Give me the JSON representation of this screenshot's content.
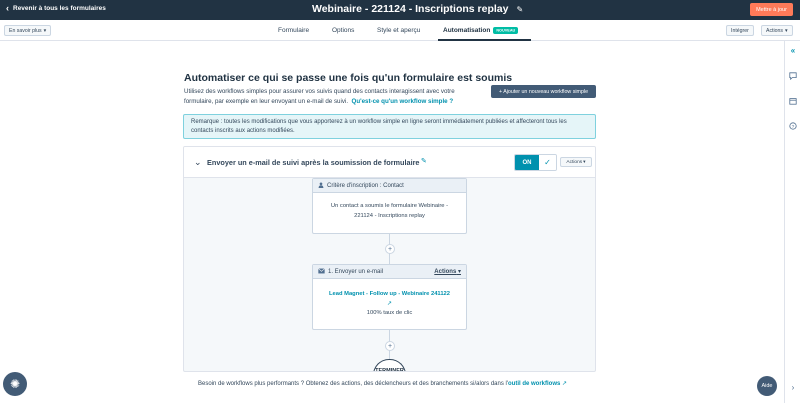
{
  "topbar": {
    "back_label": "Revenir à tous les formulaires",
    "title": "Webinaire - 221124 - Inscriptions replay",
    "update_label": "Mettre à jour"
  },
  "toolbar": {
    "learn_more_label": "En savoir plus",
    "integrate_label": "Intégrer",
    "actions_label": "Actions"
  },
  "tabs": [
    {
      "label": "Formulaire"
    },
    {
      "label": "Options"
    },
    {
      "label": "Style et aperçu"
    },
    {
      "label": "Automatisation",
      "badge": "NOUVEAU"
    }
  ],
  "main": {
    "title": "Automatiser ce qui se passe une fois qu'un formulaire est soumis",
    "intro": "Utilisez des workflows simples pour assurer vos suivis quand des contacts interagissent avec votre formulaire, par exemple en leur envoyant un e-mail de suivi.",
    "intro_link": "Qu'est-ce qu'un workflow simple ?",
    "add_workflow_label": "+ Ajouter un nouveau workflow simple",
    "notice": "Remarque : toutes les modifications que vous apporterez à un workflow simple en ligne seront immédiatement publiées et affecteront tous les contacts inscrits aux actions modifiées."
  },
  "workflow": {
    "name": "Envoyer un e-mail de suivi après la soumission de formulaire",
    "toggle_label": "ON",
    "actions_label": "Actions",
    "trigger": {
      "header": "Critère d'inscription : Contact",
      "body": "Un contact a soumis le formulaire Webinaire - 221124 - Inscriptions replay"
    },
    "step": {
      "header": "1. Envoyer un e-mail",
      "actions_label": "Actions",
      "email_link": "Lead Magnet - Follow up - Webinaire 241122",
      "stat": "100% taux de clic"
    },
    "end_label": "TERMINER"
  },
  "footer": {
    "text": "Besoin de workflows plus performants ? Obtenez des actions, des déclencheurs et des branchements si/alors dans l'",
    "link": "outil de workflows"
  },
  "help_label": "Aide",
  "icons": [
    "chevron-left-icon",
    "pencil-icon",
    "chevron-down-icon",
    "check-icon",
    "user-icon",
    "mail-icon",
    "external-link-icon",
    "plus-icon",
    "gear-icon",
    "collapse-icon",
    "chat-icon",
    "calendar-icon",
    "help-icon",
    "chevron-right-icon"
  ],
  "colors": {
    "accent": "#ff7a59",
    "teal": "#0091ae",
    "dark": "#213343",
    "badge": "#00bda5"
  }
}
